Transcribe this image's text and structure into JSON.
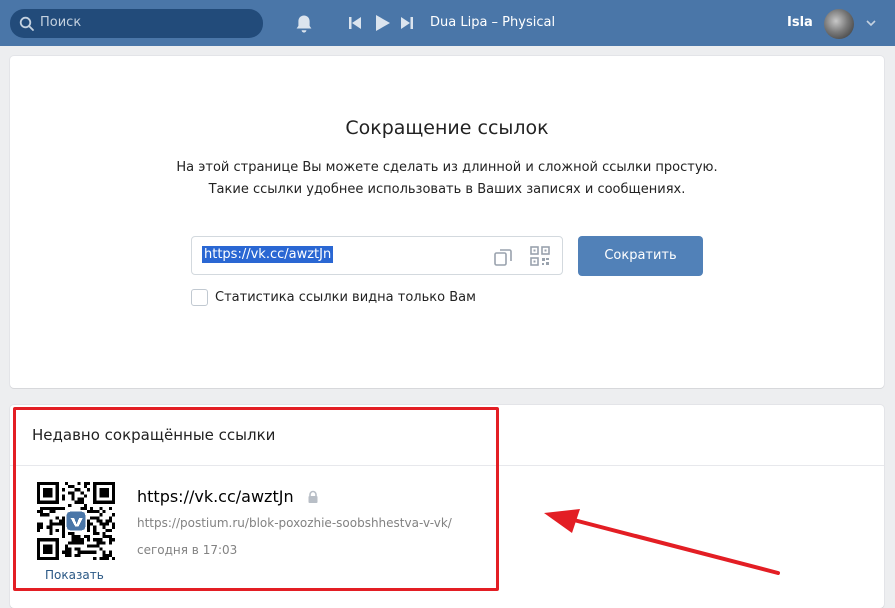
{
  "header": {
    "search_placeholder": "Поиск",
    "track": "Dua Lipa – Physical",
    "username": "Isla"
  },
  "shortener": {
    "title": "Сокращение ссылок",
    "description_line1": "На этой странице Вы можете сделать из длинной и сложной ссылки простую.",
    "description_line2": "Такие ссылки удобнее использовать в Ваших записях и сообщениях.",
    "link_value": "https://vk.cc/awztJn",
    "shorten_button": "Сократить",
    "stats_checkbox_label": "Статистика ссылки видна только Вам",
    "stats_checked": false
  },
  "recent": {
    "heading": "Недавно сокращённые ссылки",
    "items": [
      {
        "short_url": "https://vk.cc/awztJn",
        "original_url": "https://postium.ru/blok-poxozhie-soobshhestva-v-vk/",
        "time": "сегодня в 17:03",
        "show_label": "Показать"
      }
    ]
  },
  "colors": {
    "header_bg": "#4a76a8",
    "button_bg": "#5181b8",
    "annotation": "#e31e24"
  },
  "icons": [
    "search-icon",
    "bell-icon",
    "prev-icon",
    "play-icon",
    "next-icon",
    "chevron-down-icon",
    "copy-icon",
    "qr-icon",
    "lock-icon"
  ]
}
